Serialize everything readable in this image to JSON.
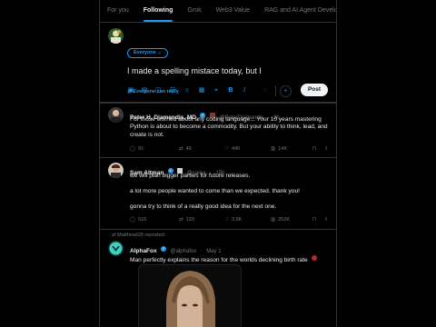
{
  "tabs": [
    "For you",
    "Following",
    "Grok",
    "Web3 Value",
    "RAG and AI Agent Develope"
  ],
  "composer": {
    "audience": "Everyone",
    "draft_text": "I made a spelling mistace today, but I",
    "reply_setting": "Everyone can reply",
    "post_label": "Post"
  },
  "posts": [
    {
      "name": "Peter H. Diamandis, MD",
      "handle": "@PeterDiamandis",
      "time": "3h",
      "text": "For those worried about any coding language... Your 10 years mastering Python is about to become a commodity. But your ability to think, lead, and create is not.",
      "replies": "91",
      "reposts": "49",
      "likes": "440",
      "views": "14K"
    },
    {
      "name": "Sam Altman",
      "handle": "@sama",
      "time": "15h",
      "text1": "we will plan bigger parties for future releases.",
      "text2": "a lot more people wanted to come than we expected. thank you!",
      "text3": "gonna try to think of a really good idea for the next one.",
      "replies": "516",
      "reposts": "133",
      "likes": "3.9K",
      "views": "252K"
    },
    {
      "reposted_by": "MatthewGB reposted",
      "name": "AlphaFox",
      "handle": "@alphafox",
      "time": "May 1",
      "text": "Man perfectly explains the reason for the worlds declining birth rate"
    }
  ],
  "colors": {
    "accent": "#1d9bf0",
    "border": "#2f3336",
    "muted": "#71767b",
    "bg": "#000000"
  }
}
